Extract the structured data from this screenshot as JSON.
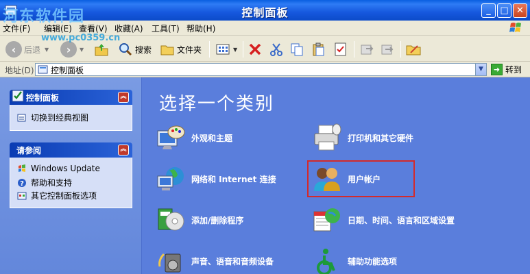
{
  "window": {
    "title": "控制面板"
  },
  "watermark": {
    "text": "河东软件园",
    "url": "www.pc0359.cn"
  },
  "menu": [
    "文件(F)",
    "编辑(E)",
    "查看(V)",
    "收藏(A)",
    "工具(T)",
    "帮助(H)"
  ],
  "toolbar": {
    "back": "后退",
    "search": "搜索",
    "folders": "文件夹"
  },
  "address": {
    "label": "地址(D)",
    "value": "控制面板",
    "go": "转到"
  },
  "sidebar": {
    "panel1": {
      "title": "控制面板",
      "links": [
        "切换到经典视图"
      ]
    },
    "panel2": {
      "title": "请参阅",
      "links": [
        "Windows Update",
        "帮助和支持",
        "其它控制面板选项"
      ]
    }
  },
  "main": {
    "heading": "选择一个类别",
    "categories": [
      {
        "label": "外观和主题",
        "icon": "appearance-icon"
      },
      {
        "label": "打印机和其它硬件",
        "icon": "printer-icon"
      },
      {
        "label": "网络和 Internet 连接",
        "icon": "network-icon"
      },
      {
        "label": "用户帐户",
        "icon": "user-accounts-icon"
      },
      {
        "label": "添加/删除程序",
        "icon": "add-remove-icon"
      },
      {
        "label": "日期、时间、语言和区域设置",
        "icon": "date-time-icon"
      },
      {
        "label": "声音、语音和音频设备",
        "icon": "sound-icon"
      },
      {
        "label": "辅助功能选项",
        "icon": "accessibility-icon"
      }
    ]
  },
  "colors": {
    "titlebar": "#0c4cc9",
    "content_bg": "#5a7edc",
    "highlight": "#d42a2a"
  }
}
